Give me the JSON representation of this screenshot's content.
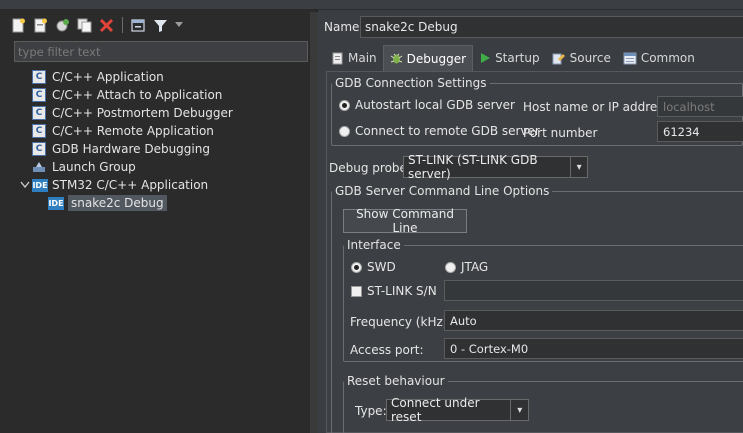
{
  "left": {
    "filter_placeholder": "type filter text",
    "tree": [
      {
        "label": "C/C++ Application",
        "icon": "c-config-icon"
      },
      {
        "label": "C/C++ Attach to Application",
        "icon": "c-config-icon"
      },
      {
        "label": "C/C++ Postmortem Debugger",
        "icon": "c-config-icon"
      },
      {
        "label": "C/C++ Remote Application",
        "icon": "c-config-icon"
      },
      {
        "label": "GDB Hardware Debugging",
        "icon": "c-config-icon"
      },
      {
        "label": "Launch Group",
        "icon": "launch-group-icon"
      },
      {
        "label": "STM32 C/C++ Application",
        "icon": "ide-icon",
        "expanded": true
      },
      {
        "label": "snake2c Debug",
        "icon": "ide-icon",
        "selected": true
      }
    ],
    "icon_c_text": "C",
    "icon_ide_text": "IDE"
  },
  "right": {
    "name_label": "Name:",
    "name_value": "snake2c Debug",
    "tabs": [
      {
        "label": "Main",
        "icon": "main-tab-icon"
      },
      {
        "label": "Debugger",
        "icon": "debugger-bug-icon",
        "active": true
      },
      {
        "label": "Startup",
        "icon": "startup-play-icon"
      },
      {
        "label": "Source",
        "icon": "source-icon"
      },
      {
        "label": "Common",
        "icon": "common-icon"
      }
    ],
    "gdb_connection": {
      "legend": "GDB Connection Settings",
      "autostart_label": "Autostart local GDB server",
      "connect_remote_label": "Connect to remote GDB server",
      "host_label": "Host name or IP address",
      "host_value": "localhost",
      "port_label": "Port number",
      "port_value": "61234"
    },
    "debug_probe_label": "Debug probe",
    "debug_probe_value": "ST-LINK (ST-LINK GDB server)",
    "gdb_server_options": {
      "legend": "GDB Server Command Line Options",
      "show_cmd_button": "Show Command Line",
      "interface": {
        "legend": "Interface",
        "swd_label": "SWD",
        "jtag_label": "JTAG",
        "stlink_sn_label": "ST-LINK S/N",
        "stlink_sn_value": "",
        "frequency_label": "Frequency (kHz):",
        "frequency_value": "Auto",
        "access_port_label": "Access port:",
        "access_port_value": "0 - Cortex-M0"
      },
      "reset": {
        "legend": "Reset behaviour",
        "type_label": "Type:",
        "type_value": "Connect under reset"
      }
    }
  },
  "colors": {
    "accent_blue": "#2f7fc0",
    "selection": "#525860"
  }
}
